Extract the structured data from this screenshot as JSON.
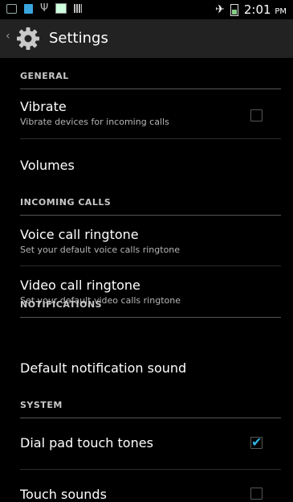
{
  "status_bar": {
    "time": "2:01",
    "ampm": "PM",
    "icons": [
      "voicemail-icon",
      "bbm-icon",
      "usb-icon",
      "image-icon",
      "barcode-icon",
      "airplane-icon",
      "battery-icon"
    ]
  },
  "action_bar": {
    "title": "Settings",
    "icon": "gear-icon"
  },
  "sections": {
    "general": "GENERAL",
    "incoming_calls": "INCOMING CALLS",
    "notifications": "NOTIFICATIONS",
    "system": "SYSTEM"
  },
  "items": {
    "vibrate": {
      "title": "Vibrate",
      "summary": "Vibrate devices for incoming calls",
      "checked": false
    },
    "volumes": {
      "title": "Volumes"
    },
    "voice_ringtone": {
      "title": "Voice call ringtone",
      "summary": "Set your default voice calls ringtone"
    },
    "video_ringtone": {
      "title": "Video call ringtone",
      "summary": "Set your default video calls ringtone"
    },
    "notification_sound": {
      "title": "Default notification sound"
    },
    "dial_pad_tones": {
      "title": "Dial pad touch tones",
      "checked": true
    },
    "touch_sounds": {
      "title": "Touch sounds",
      "checked": false
    }
  },
  "colors": {
    "accent": "#33b5e5",
    "background": "#000000",
    "action_bar": "#222222"
  }
}
